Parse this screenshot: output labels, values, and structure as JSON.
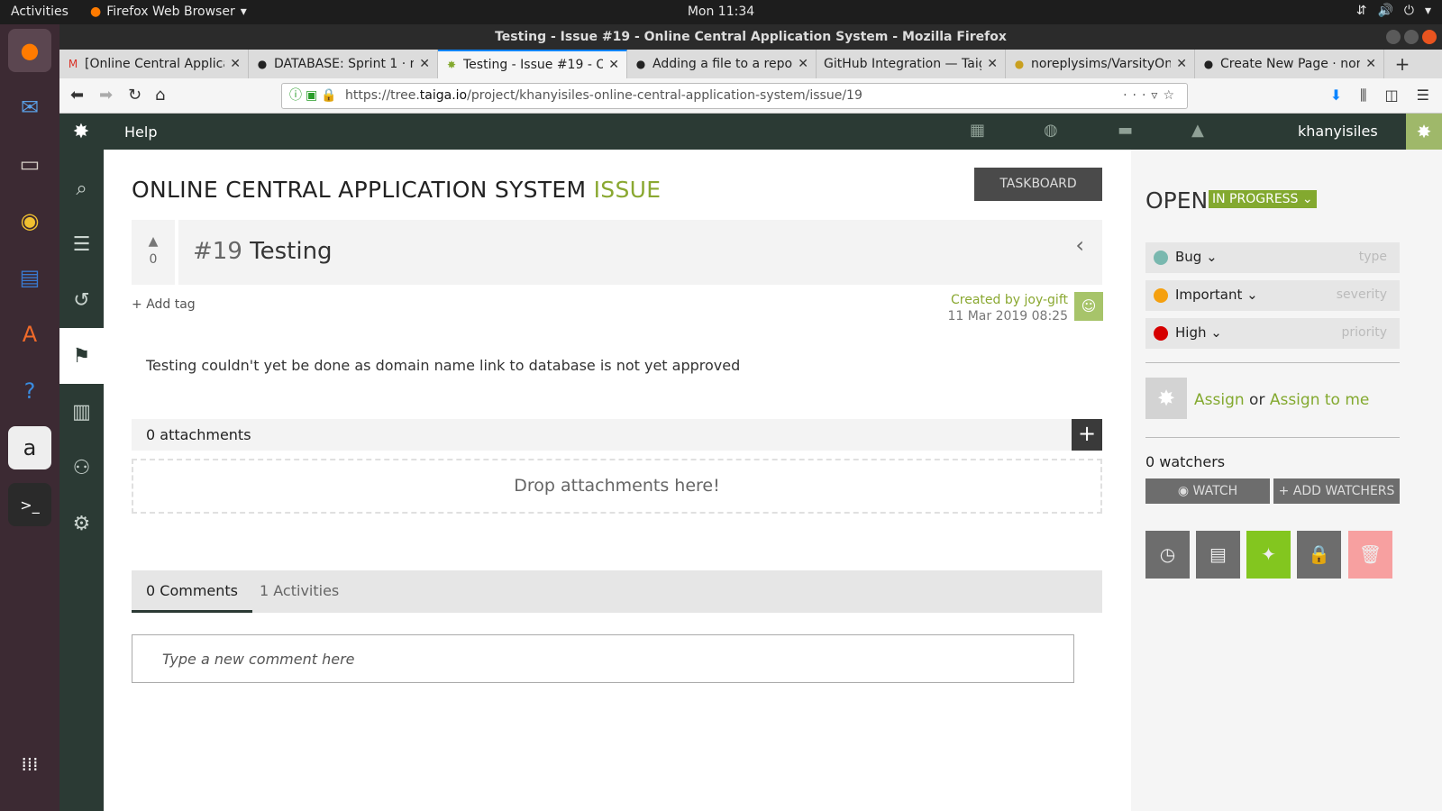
{
  "desktop": {
    "activities": "Activities",
    "app_name": "Firefox Web Browser",
    "clock": "Mon 11:34",
    "dock_items": [
      "firefox-icon",
      "thunderbird-icon",
      "files-icon",
      "rhythmbox-icon",
      "writer-icon",
      "software-center-icon",
      "help-icon",
      "amazon-icon",
      "terminal-icon",
      "app-grid-icon"
    ]
  },
  "window": {
    "title": "Testing - Issue #19 - Online Central Application System - Mozilla Firefox"
  },
  "tabs": [
    {
      "label": "[Online Central Applica"
    },
    {
      "label": "DATABASE: Sprint 1 · nc"
    },
    {
      "label": "Testing - Issue #19 - Onl"
    },
    {
      "label": "Adding a file to a repos"
    },
    {
      "label": "GitHub Integration — Taig"
    },
    {
      "label": "noreplysims/VarsityOn"
    },
    {
      "label": "Create New Page · nore"
    }
  ],
  "urlbar": {
    "url_prefix": "https://tree.",
    "url_host": "taiga.io",
    "url_path": "/project/khanyisiles-online-central-application-system/issue/19"
  },
  "taiga": {
    "help": "Help",
    "username": "khanyisiles",
    "project": "ONLINE CENTRAL APPLICATION SYSTEM",
    "section": "ISSUE",
    "taskboard": "TASKBOARD",
    "votes": "0",
    "ref": "#19",
    "subject": "Testing",
    "add_tag": "Add tag",
    "created_by": "Created by joy-gift",
    "created_date": "11 Mar 2019 08:25",
    "description": "Testing couldn't yet be done as domain name link to database is not yet approved",
    "attachments_label": "0 attachments",
    "drop_label": "Drop attachments here!",
    "comments_tab": "0 Comments",
    "activities_tab": "1 Activities",
    "comment_placeholder": "Type a new comment here"
  },
  "sidebar": {
    "status_open": "OPEN",
    "status_progress": "IN PROGRESS",
    "type": {
      "value": "Bug",
      "key": "type",
      "color": "#79b8af"
    },
    "severity": {
      "value": "Important",
      "key": "severity",
      "color": "#f5a00f"
    },
    "priority": {
      "value": "High",
      "key": "priority",
      "color": "#d60000"
    },
    "assign": "Assign",
    "or": "or",
    "assign_me": "Assign to me",
    "watchers": "0 watchers",
    "watch_btn": "WATCH",
    "add_watchers_btn": "+ ADD WATCHERS"
  }
}
